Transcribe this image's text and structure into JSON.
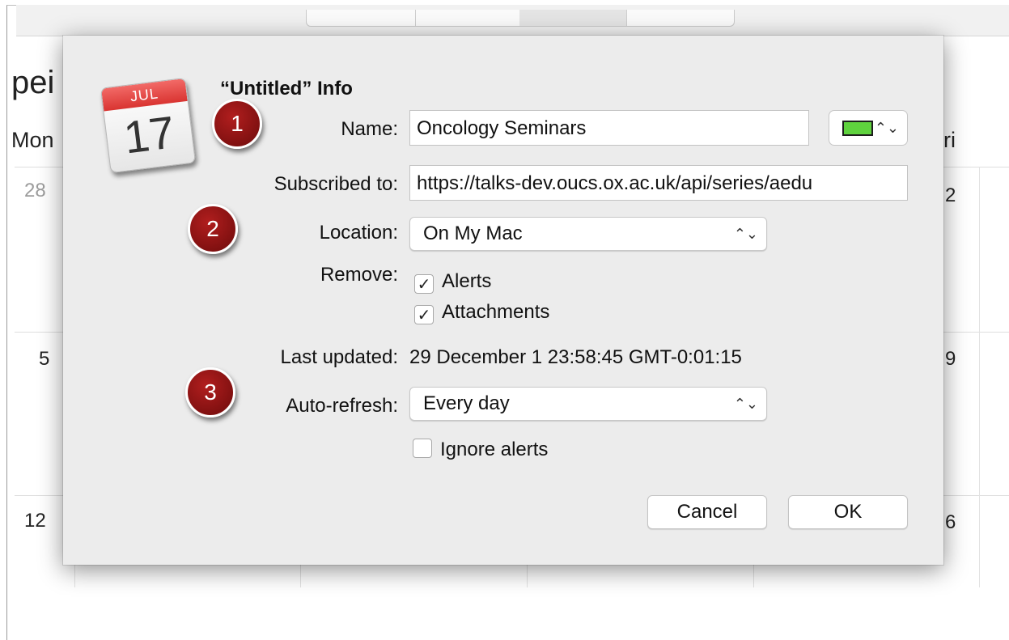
{
  "background": {
    "month_fragment": "pei",
    "weekday_left": "Mon",
    "weekday_right": "ri",
    "day_numbers_left": [
      "28",
      "5",
      "12"
    ],
    "day_numbers_right": [
      "2",
      "9",
      "6"
    ]
  },
  "dialog": {
    "title": "“Untitled” Info",
    "icon": {
      "month": "JUL",
      "day": "17",
      "name": "calendar-app-icon"
    },
    "name_label": "Name:",
    "name_value": "Oncology Seminars",
    "color": "#5fd23e",
    "subscribed_label": "Subscribed to:",
    "subscribed_value": "https://talks-dev.oucs.ox.ac.uk/api/series/aedu",
    "location_label": "Location:",
    "location_value": "On My Mac",
    "remove_label": "Remove:",
    "remove_alerts_label": "Alerts",
    "remove_alerts_checked": true,
    "remove_attachments_label": "Attachments",
    "remove_attachments_checked": true,
    "last_updated_label": "Last updated:",
    "last_updated_value": "29 December 1 23:58:45 GMT-0:01:15",
    "autorefresh_label": "Auto-refresh:",
    "autorefresh_value": "Every day",
    "ignore_alerts_label": "Ignore alerts",
    "ignore_alerts_checked": false,
    "cancel_label": "Cancel",
    "ok_label": "OK",
    "check_glyph": "✓",
    "popup_arrows": "⌃⌄"
  },
  "annotations": [
    {
      "label": "1"
    },
    {
      "label": "2"
    },
    {
      "label": "3"
    }
  ],
  "colors": {
    "badge": "#8b1313",
    "dialog_bg": "#ececec",
    "calendar_band": "#e24a47"
  }
}
